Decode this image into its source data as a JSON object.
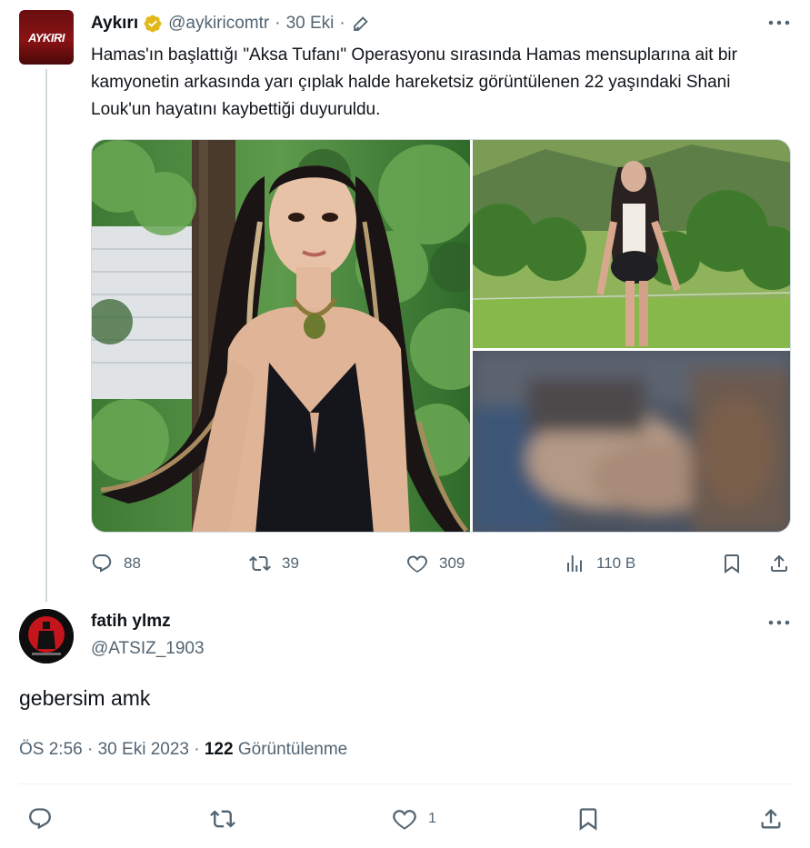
{
  "parent": {
    "logo_text": "AYKIRI",
    "name": "Aykırı",
    "handle": "@aykiricomtr",
    "separator": "·",
    "date": "30 Eki",
    "separator2": "·",
    "text": "Hamas'ın başlattığı \"Aksa Tufanı\" Operasyonu sırasında Hamas mensuplarına ait bir kamyonetin arkasında yarı çıplak halde hareketsiz görüntülenen 22 yaşındaki  Shani Louk'un hayatını kaybettiği duyuruldu.",
    "icons": {
      "verified": "verified-badge-icon",
      "edited": "pen-icon",
      "more": "more-icon"
    },
    "stats": {
      "replies": "88",
      "retweets": "39",
      "likes": "309",
      "views": "110 B"
    }
  },
  "reply": {
    "name": "fatih ylmz",
    "handle": "@ATSIZ_1903",
    "text": "gebersim amk",
    "time": "ÖS 2:56",
    "dot1": "·",
    "date": "30 Eki 2023",
    "dot2": "·",
    "views_count": "122",
    "views_label": "Görüntülenme",
    "stats": {
      "likes": "1"
    }
  },
  "colors": {
    "text": "#0f1419",
    "secondary": "#536471",
    "divider": "#eff3f4",
    "thread_line": "#cfd9de",
    "verified_gold": "#e2b719"
  }
}
